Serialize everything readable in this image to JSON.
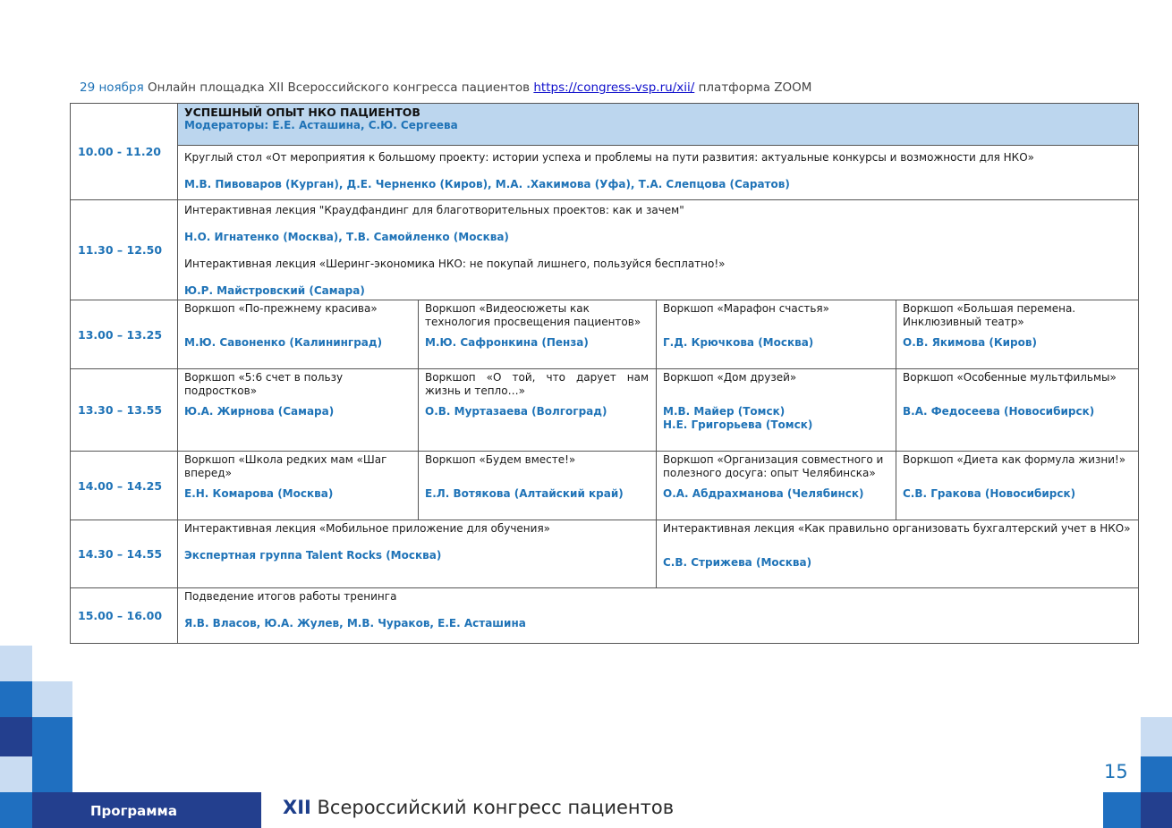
{
  "header": {
    "date": "29 ноября",
    "text": " Онлайн площадка XII Всероссийского конгресса пациентов ",
    "link": "https://congress-vsp.ru/xii/",
    "platform": " платформа ZOOM"
  },
  "rows": [
    {
      "time": "10.00 - 11.20",
      "session_title": "УСПЕШНЫЙ ОПЫТ НКО ПАЦИЕНТОВ",
      "moderators": "Модераторы: Е.Е. Асташина, С.Ю. Сергеева",
      "event": "Круглый стол «От мероприятия к большому проекту: истории успеха и проблемы на пути развития: актуальные конкурсы и возможности для НКО»",
      "speakers": "М.В. Пивоваров (Курган), Д.Е. Черненко (Киров), М.А. .Хакимова (Уфа), Т.А. Слепцова (Саратов)"
    },
    {
      "time": "11.30 – 12.50",
      "event1": "Интерактивная лекция \"Краудфандинг для благотворительных проектов: как и зачем\"",
      "speakers1": "Н.О. Игнатенко (Москва), Т.В. Самойленко (Москва)",
      "event2": "Интерактивная лекция «Шеринг-экономика НКО: не покупай лишнего, пользуйся бесплатно!»",
      "speakers2": "Ю.Р. Майстровский (Самара)"
    },
    {
      "time": "13.00 – 13.25",
      "cells": [
        {
          "event": "Воркшоп «По-прежнему красива»",
          "speakers": "М.Ю. Савоненко (Калининград)"
        },
        {
          "event": " Воркшоп «Видеосюжеты как технология просвещения пациентов»",
          "speakers": "М.Ю. Сафронкина (Пенза)"
        },
        {
          "event": "Воркшоп «Марафон счастья»",
          "speakers": "Г.Д. Крючкова (Москва)"
        },
        {
          "event": "Воркшоп «Большая перемена. Инклюзивный театр»",
          "speakers": "О.В. Якимова (Киров)"
        }
      ]
    },
    {
      "time": "13.30 – 13.55",
      "cells": [
        {
          "event": "Воркшоп «5:6 счет в пользу подростков»",
          "speakers": "Ю.А. Жирнова (Самара)"
        },
        {
          "event": "Воркшоп «О той, что дарует нам жизнь и тепло…»",
          "speakers": "О.В. Муртазаева (Волгоград)"
        },
        {
          "event": "Воркшоп «Дом друзей»",
          "speakers": "М.В. Майер (Томск)",
          "speakers_extra": "Н.Е. Григорьева (Томск)"
        },
        {
          "event": "Воркшоп «Особенные мультфильмы»",
          "speakers": "В.А. Федосеева (Новосибирск)"
        }
      ]
    },
    {
      "time": "14.00 – 14.25",
      "cells": [
        {
          "event": "Воркшоп «Школа редких мам «Шаг вперед»",
          "speakers": "Е.Н. Комарова (Москва)"
        },
        {
          "event": "Воркшоп «Будем вместе!»",
          "speakers": "Е.Л. Вотякова (Алтайский край)"
        },
        {
          "event": "Воркшоп «Организация совместного и полезного досуга: опыт Челябинска»",
          "speakers": "О.А. Абдрахманова (Челябинск)"
        },
        {
          "event": "Воркшоп «Диета как формула жизни!»",
          "speakers": "С.В. Гракова (Новосибирск)"
        }
      ]
    },
    {
      "time": "14.30 – 14.55",
      "cells": [
        {
          "event": "Интерактивная лекция «Мобильное приложение для обучения»",
          "speakers": "Экспертная группа Talent Rocks (Москва)"
        },
        {
          "event": "Интерактивная лекция «Как правильно организовать бухгалтерский учет в НКО»",
          "speakers": "С.В. Стрижева (Москва)"
        }
      ]
    },
    {
      "time": "15.00 – 16.00",
      "event": "Подведение итогов работы тренинга",
      "speakers": "Я.В. Власов, Ю.А. Жулев, М.В. Чураков, Е.Е. Асташина"
    }
  ],
  "footer": {
    "label": "Программа",
    "title_prefix": "XII",
    "title_rest": " Всероссийский конгресс пациентов",
    "page_number": "15"
  },
  "colors": {
    "accent_blue": "#1f73b7",
    "header_fill": "#bcd6ee",
    "footer_navy": "#233f8e"
  }
}
